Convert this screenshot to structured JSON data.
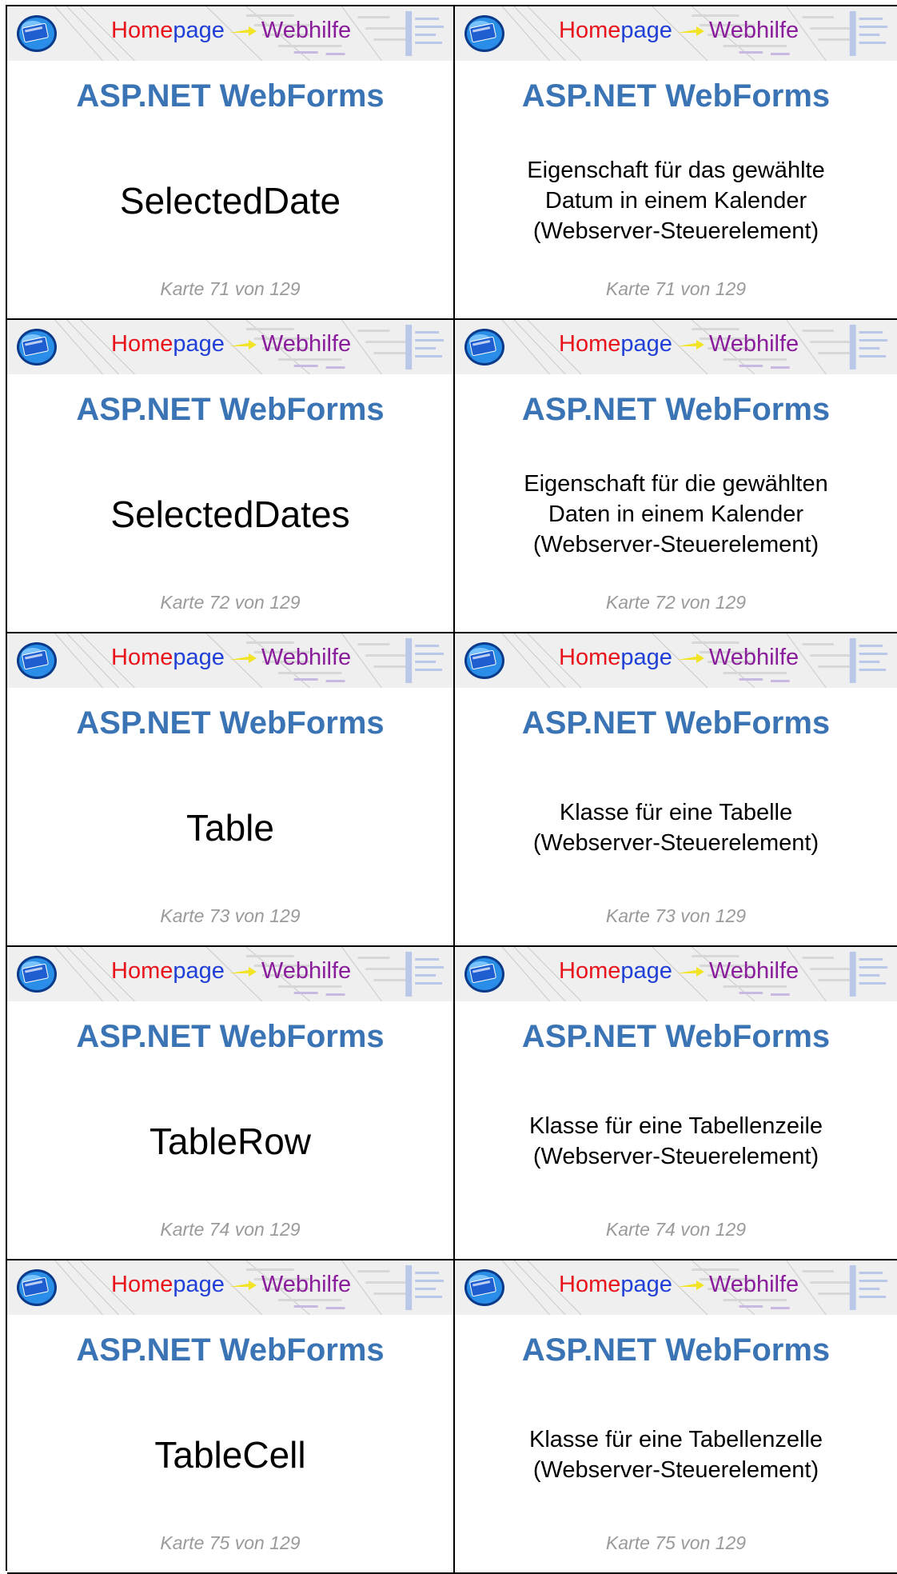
{
  "banner": {
    "home": "Home",
    "page": "page",
    "web": "Webhilfe"
  },
  "cards": [
    {
      "title": "ASP.NET WebForms",
      "term": "SelectedDate",
      "definition": "Eigenschaft für das gewählte\nDatum in einem Kalender\n(Webserver-Steuerelement)",
      "counter": "Karte 71 von 129"
    },
    {
      "title": "ASP.NET WebForms",
      "term": "SelectedDates",
      "definition": "Eigenschaft für die gewählten\nDaten in einem Kalender\n(Webserver-Steuerelement)",
      "counter": "Karte 72 von 129"
    },
    {
      "title": "ASP.NET WebForms",
      "term": "Table",
      "definition": "Klasse für eine Tabelle\n(Webserver-Steuerelement)",
      "counter": "Karte 73 von 129"
    },
    {
      "title": "ASP.NET WebForms",
      "term": "TableRow",
      "definition": "Klasse für eine Tabellenzeile\n(Webserver-Steuerelement)",
      "counter": "Karte 74 von 129"
    },
    {
      "title": "ASP.NET WebForms",
      "term": "TableCell",
      "definition": "Klasse für eine Tabellenzelle\n(Webserver-Steuerelement)",
      "counter": "Karte 75 von 129"
    }
  ],
  "colors": {
    "title": "#3a74b5",
    "home": "#e8131b",
    "page": "#1f3fd6",
    "web": "#8a1d9c",
    "counter": "#9a9a9a"
  }
}
